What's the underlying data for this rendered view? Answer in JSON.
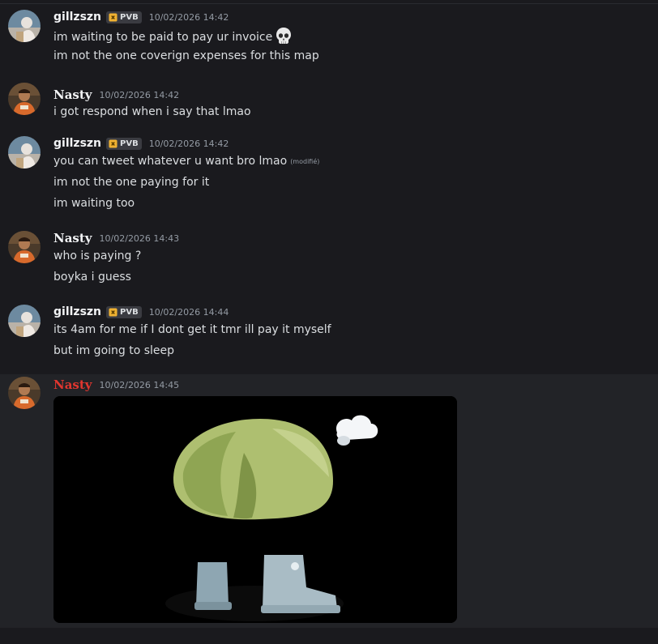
{
  "messages": [
    {
      "author": "gillzszn",
      "tag": "PVB",
      "timestamp": "10/02/2026 14:42",
      "lines": [
        "im waiting to be paid to pay ur invoice",
        "im not the one coverign expenses for this map"
      ],
      "emoji": "skull-emoji"
    },
    {
      "author": "Nasty",
      "timestamp": "10/02/2026 14:42",
      "lines": [
        "i got respond when i say that lmao"
      ]
    },
    {
      "author": "gillzszn",
      "tag": "PVB",
      "timestamp": "10/02/2026 14:42",
      "lines": [
        "you can tweet whatever u want bro lmao",
        "im not the one paying for it",
        "im waiting too"
      ],
      "edited_label": "(modifié)"
    },
    {
      "author": "Nasty",
      "timestamp": "10/02/2026 14:43",
      "lines": [
        "who is paying ?",
        "boyka i guess"
      ]
    },
    {
      "author": "gillzszn",
      "tag": "PVB",
      "timestamp": "10/02/2026 14:44",
      "lines": [
        "its 4am for me if I dont get it tmr ill pay it myself",
        "but im going to sleep"
      ]
    },
    {
      "author": "Nasty",
      "author_color": "#e0362f",
      "timestamp": "10/02/2026 14:45",
      "attachment": "gif-image"
    }
  ],
  "colors": {
    "background": "#1a1a1e",
    "highlight": "#222327",
    "text": "#dbdee1",
    "muted": "#949ba4",
    "nasty_red": "#e0362f"
  }
}
